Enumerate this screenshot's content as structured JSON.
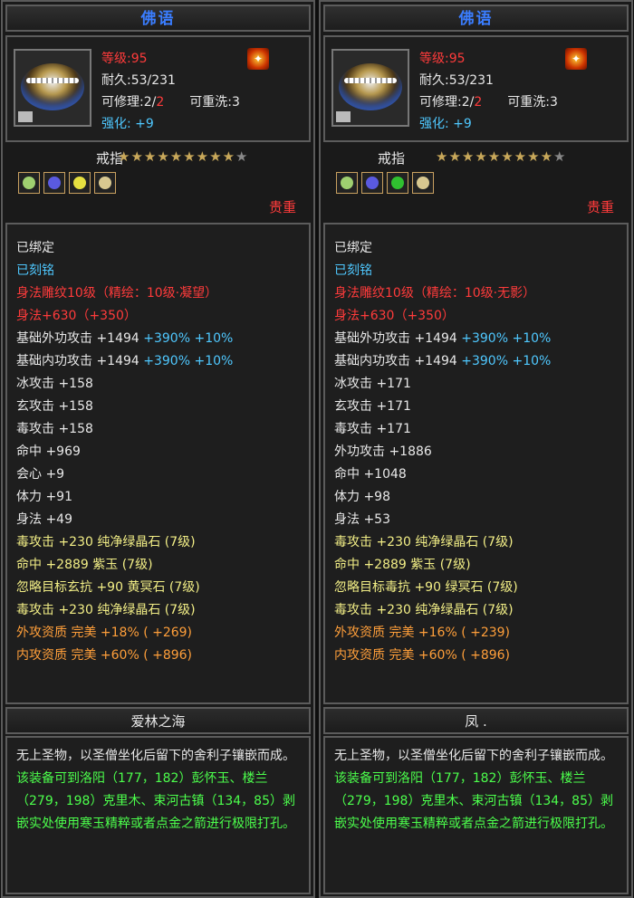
{
  "panels": [
    {
      "title": "佛语",
      "level_label": "等级",
      "level_value": ":95",
      "durability": "耐久:53/231",
      "repair_label": "可修理:2/",
      "repair_max": "2",
      "rewash": "可重洗:3",
      "enhance_label": "强化:",
      "enhance_value": "+9",
      "item_type": "戒指",
      "stars_on": "★★★★★★★★★",
      "stars_off": "★",
      "gem_colors": [
        "#9fd070",
        "#5a5ae0",
        "#e6e040",
        "#d8c890"
      ],
      "rarity": "贵重",
      "stats": [
        {
          "text": "已绑定",
          "cls": "c-white"
        },
        {
          "text": "已刻铭",
          "cls": "c-blue"
        },
        {
          "text": "身法雕纹10级（精绘：10级·凝望）",
          "cls": "c-red"
        },
        {
          "text": "身法+630（+350）",
          "cls": "c-red"
        },
        {
          "text": "基础外功攻击  +1494 ",
          "extra": "+390% +10%",
          "cls": "c-white"
        },
        {
          "text": "基础内功攻击  +1494 ",
          "extra": "+390% +10%",
          "cls": "c-white"
        },
        {
          "text": "冰攻击  +158",
          "cls": "c-white"
        },
        {
          "text": "玄攻击  +158",
          "cls": "c-white"
        },
        {
          "text": "毒攻击  +158",
          "cls": "c-white"
        },
        {
          "text": "命中  +969",
          "cls": "c-white"
        },
        {
          "text": "会心  +9",
          "cls": "c-white"
        },
        {
          "text": "体力  +91",
          "cls": "c-white"
        },
        {
          "text": "身法  +49",
          "cls": "c-white"
        },
        {
          "text": "毒攻击  +230  纯净绿晶石 (7级)",
          "cls": "c-yel"
        },
        {
          "text": "命中  +2889  紫玉 (7级)",
          "cls": "c-yel"
        },
        {
          "text": "忽略目标玄抗  +90  黄冥石 (7级)",
          "cls": "c-yel"
        },
        {
          "text": "毒攻击  +230  纯净绿晶石 (7级)",
          "cls": "c-yel"
        },
        {
          "text": "外攻资质   完美  +18%  ( +269)",
          "cls": "c-org"
        },
        {
          "text": "内攻资质   完美  +60%  ( +896)",
          "cls": "c-org"
        }
      ],
      "signature": "爱林之海",
      "desc_white": "无上圣物，以圣僧坐化后留下的舍利子镶嵌而成。",
      "desc_green": "该装备可到洛阳（177，182）彭怀玉、楼兰（279，198）克里木、束河古镇（134，85）剥嵌实处使用寒玉精粹或者点金之箭进行极限打孔。"
    },
    {
      "title": "佛语",
      "level_label": "等级",
      "level_value": ":95",
      "durability": "耐久:53/231",
      "repair_label": "可修理:2/",
      "repair_max": "2",
      "rewash": "可重洗:3",
      "enhance_label": "强化:",
      "enhance_value": "+9",
      "item_type": "戒指",
      "stars_on": "★★★★★★★★★",
      "stars_off": "★",
      "gem_colors": [
        "#9fd070",
        "#5a5ae0",
        "#30c030",
        "#d8c890"
      ],
      "rarity": "贵重",
      "stats": [
        {
          "text": "已绑定",
          "cls": "c-white"
        },
        {
          "text": "已刻铭",
          "cls": "c-blue"
        },
        {
          "text": "身法雕纹10级（精绘：10级·无影）",
          "cls": "c-red"
        },
        {
          "text": "身法+630（+350）",
          "cls": "c-red"
        },
        {
          "text": "基础外功攻击  +1494 ",
          "extra": "+390% +10%",
          "cls": "c-white"
        },
        {
          "text": "基础内功攻击  +1494 ",
          "extra": "+390% +10%",
          "cls": "c-white"
        },
        {
          "text": "冰攻击  +171",
          "cls": "c-white"
        },
        {
          "text": "玄攻击  +171",
          "cls": "c-white"
        },
        {
          "text": "毒攻击  +171",
          "cls": "c-white"
        },
        {
          "text": "外功攻击  +1886",
          "cls": "c-white"
        },
        {
          "text": "命中  +1048",
          "cls": "c-white"
        },
        {
          "text": "体力  +98",
          "cls": "c-white"
        },
        {
          "text": "身法  +53",
          "cls": "c-white"
        },
        {
          "text": "毒攻击  +230  纯净绿晶石 (7级)",
          "cls": "c-yel"
        },
        {
          "text": "命中  +2889  紫玉 (7级)",
          "cls": "c-yel"
        },
        {
          "text": "忽略目标毒抗  +90  绿冥石 (7级)",
          "cls": "c-yel"
        },
        {
          "text": "毒攻击  +230  纯净绿晶石 (7级)",
          "cls": "c-yel"
        },
        {
          "text": "外攻资质   完美  +16%  ( +239)",
          "cls": "c-org"
        },
        {
          "text": "内攻资质   完美  +60%  ( +896)",
          "cls": "c-org"
        }
      ],
      "signature": "凤 .",
      "desc_white": "无上圣物，以圣僧坐化后留下的舍利子镶嵌而成。",
      "desc_green": "该装备可到洛阳（177，182）彭怀玉、楼兰（279，198）克里木、束河古镇（134，85）剥嵌实处使用寒玉精粹或者点金之箭进行极限打孔。"
    }
  ]
}
